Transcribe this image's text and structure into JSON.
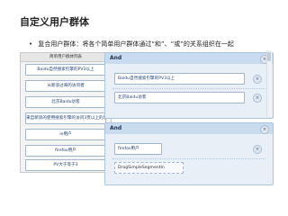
{
  "title": "自定义用户群体",
  "bullet": {
    "symbol": "•",
    "text": "复合用户群体：将各个简单用户群体通过“和”、“或”的关系组织在一起"
  },
  "left_panel": {
    "header": "简单用户群体列表",
    "items": [
      "Baidu自然搜索引擎的PV3以上",
      "从新浪过来的访问者",
      "北京Baidu访客",
      "来自新浪的使用搜索引擎的访问3页以上的客户",
      "ie用户",
      "firefox用户",
      "PV大于等于3"
    ]
  },
  "groups": [
    {
      "header": "And",
      "slots": [
        "Baidu自然搜索引擎的PV3以上",
        "北京Baidu访客"
      ]
    },
    {
      "header": "And",
      "slots": [
        "firefox用户",
        "DragSimpleSegmentIn"
      ]
    }
  ],
  "controls": {
    "close_symbol": "×"
  },
  "colors": {
    "group_header": "#c9dcef",
    "group_body": "#e8eff7",
    "item_text": "#1e3f73",
    "item_border": "#9fb6cc"
  }
}
